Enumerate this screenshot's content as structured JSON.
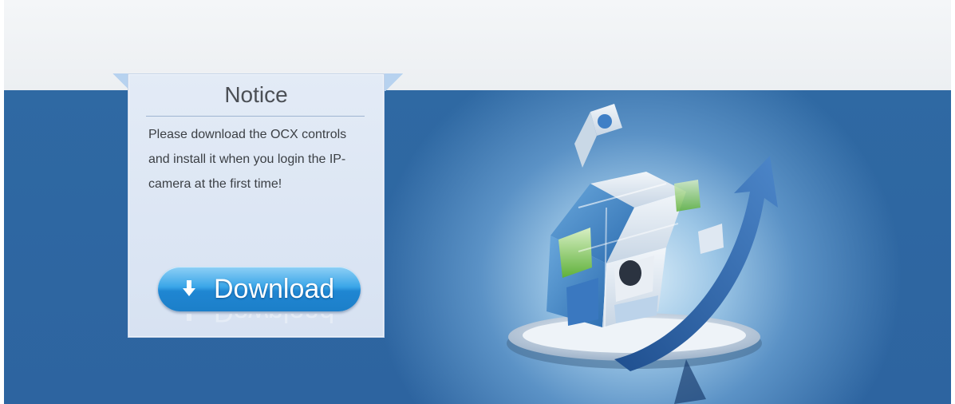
{
  "notice": {
    "title": "Notice",
    "message": "Please download the OCX controls and install it when you login the IP-camera at the first time!"
  },
  "download_button": {
    "label": "Download",
    "icon": "download-arrow-icon"
  },
  "colors": {
    "hero_blue": "#2f69a3",
    "button_blue": "#1f86d2",
    "notice_bg": "#dde6f4",
    "title_text": "#4b4f55"
  }
}
